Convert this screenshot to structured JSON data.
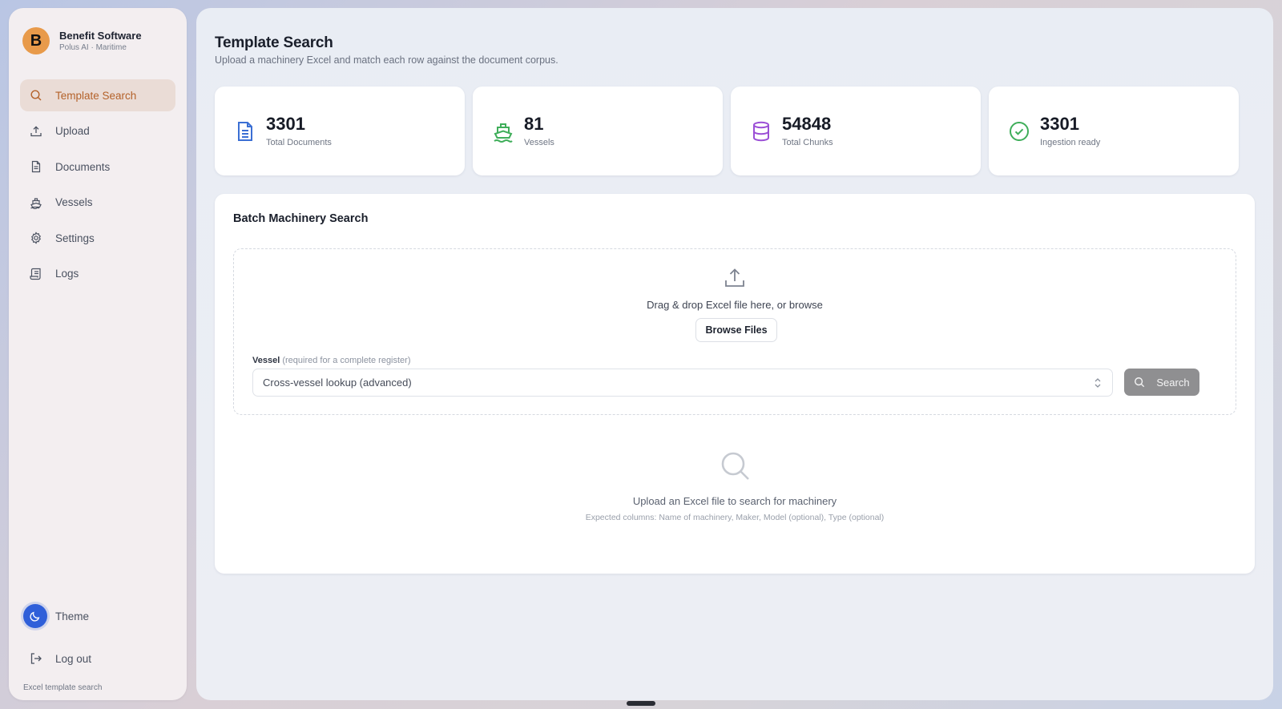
{
  "brand": {
    "logo_letter": "B",
    "name": "Benefit Software",
    "subtitle": "Polus AI · Maritime",
    "accent": "#e89a4a"
  },
  "sidebar": {
    "items": [
      {
        "label": "Template Search",
        "icon": "search-icon",
        "active": true
      },
      {
        "label": "Upload",
        "icon": "upload-icon",
        "active": false
      },
      {
        "label": "Documents",
        "icon": "document-icon",
        "active": false
      },
      {
        "label": "Vessels",
        "icon": "ship-icon",
        "active": false
      },
      {
        "label": "Settings",
        "icon": "gear-icon",
        "active": false
      },
      {
        "label": "Logs",
        "icon": "logs-icon",
        "active": false
      }
    ],
    "theme_label": "Theme",
    "logout_label": "Log out",
    "footer": "Excel template search",
    "active_color": "#b4622a"
  },
  "header": {
    "title": "Template Search",
    "subtitle": "Upload a machinery Excel and match each row against the document corpus."
  },
  "stats": [
    {
      "value": "3301",
      "label": "Total Documents",
      "icon": "document-icon",
      "color": "#3b6fd4"
    },
    {
      "value": "81",
      "label": "Vessels",
      "icon": "ship-icon",
      "color": "#3fae5a"
    },
    {
      "value": "54848",
      "label": "Total Chunks",
      "icon": "database-icon",
      "color": "#9b4fd6"
    },
    {
      "value": "3301",
      "label": "Ingestion ready",
      "icon": "check-circle-icon",
      "color": "#3fae5a"
    }
  ],
  "batch": {
    "title": "Batch Machinery Search",
    "drop_text": "Drag & drop Excel file here, or browse",
    "browse_label": "Browse Files",
    "vessel_label": "Vessel",
    "vessel_hint": "(required for a complete register)",
    "vessel_value": "Cross-vessel lookup (advanced)",
    "search_label": "Search",
    "empty_title": "Upload an Excel file to search for machinery",
    "empty_sub": "Expected columns: Name of machinery, Maker, Model (optional), Type (optional)"
  }
}
